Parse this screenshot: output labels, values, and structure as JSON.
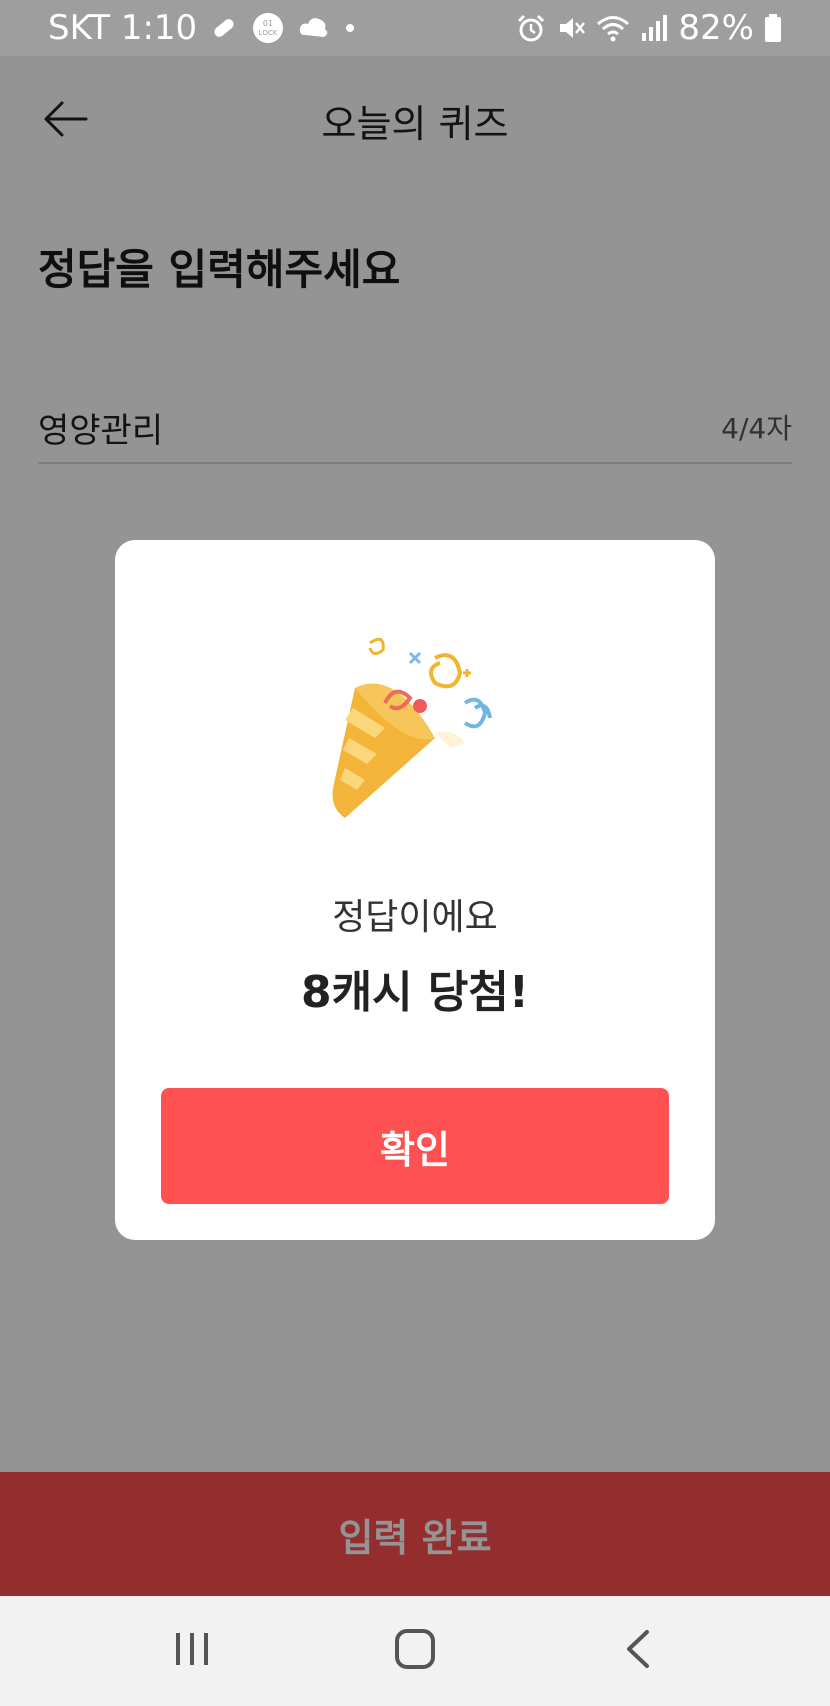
{
  "status_bar": {
    "carrier_time": "SKT 1:10",
    "battery": "82%",
    "icons": [
      "pill-icon",
      "lock-badge-icon",
      "cloud-icon",
      "dot-icon",
      "alarm-icon",
      "mute-icon",
      "wifi-icon",
      "signal-icon",
      "battery-icon"
    ]
  },
  "header": {
    "title": "오늘의 퀴즈",
    "back_icon": "arrow-left-icon"
  },
  "content": {
    "prompt": "정답을 입력해주세요",
    "answer_value": "영양관리",
    "char_count": "4/4자"
  },
  "submit": {
    "label": "입력 완료",
    "color": "#ff4f4f"
  },
  "modal": {
    "subtitle": "정답이에요",
    "title": "8캐시 당첨!",
    "confirm_label": "확인",
    "illustration": "party-popper-icon",
    "accent_color": "#ff5151"
  },
  "nav_bar": {
    "icons": [
      "recent-apps-icon",
      "home-icon",
      "back-icon"
    ]
  }
}
